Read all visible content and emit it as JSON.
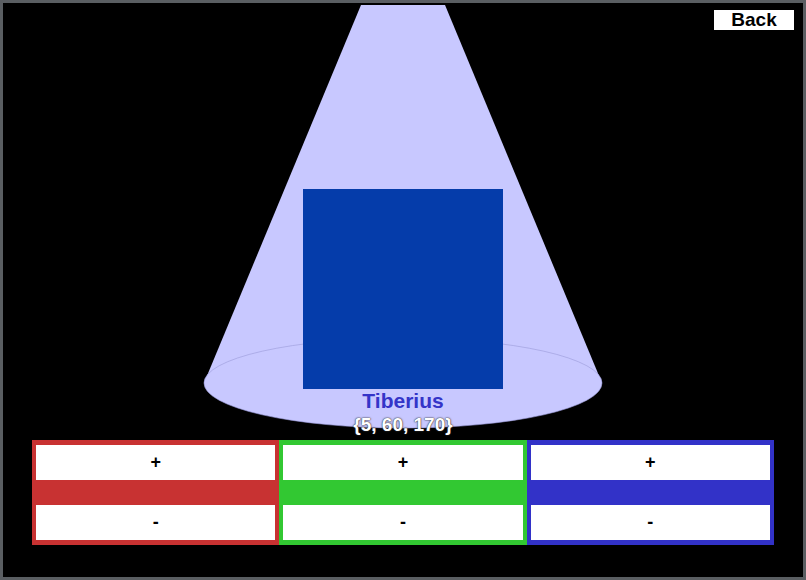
{
  "back_button": {
    "label": "Back"
  },
  "swatch": {
    "name": "Tiberius",
    "value": "{5, 60, 170}",
    "color": "#053caa"
  },
  "channels": [
    {
      "color": "#c83232",
      "increase_label": "+",
      "decrease_label": "-"
    },
    {
      "color": "#32c832",
      "increase_label": "+",
      "decrease_label": "-"
    },
    {
      "color": "#3232c8",
      "increase_label": "+",
      "decrease_label": "-"
    }
  ]
}
